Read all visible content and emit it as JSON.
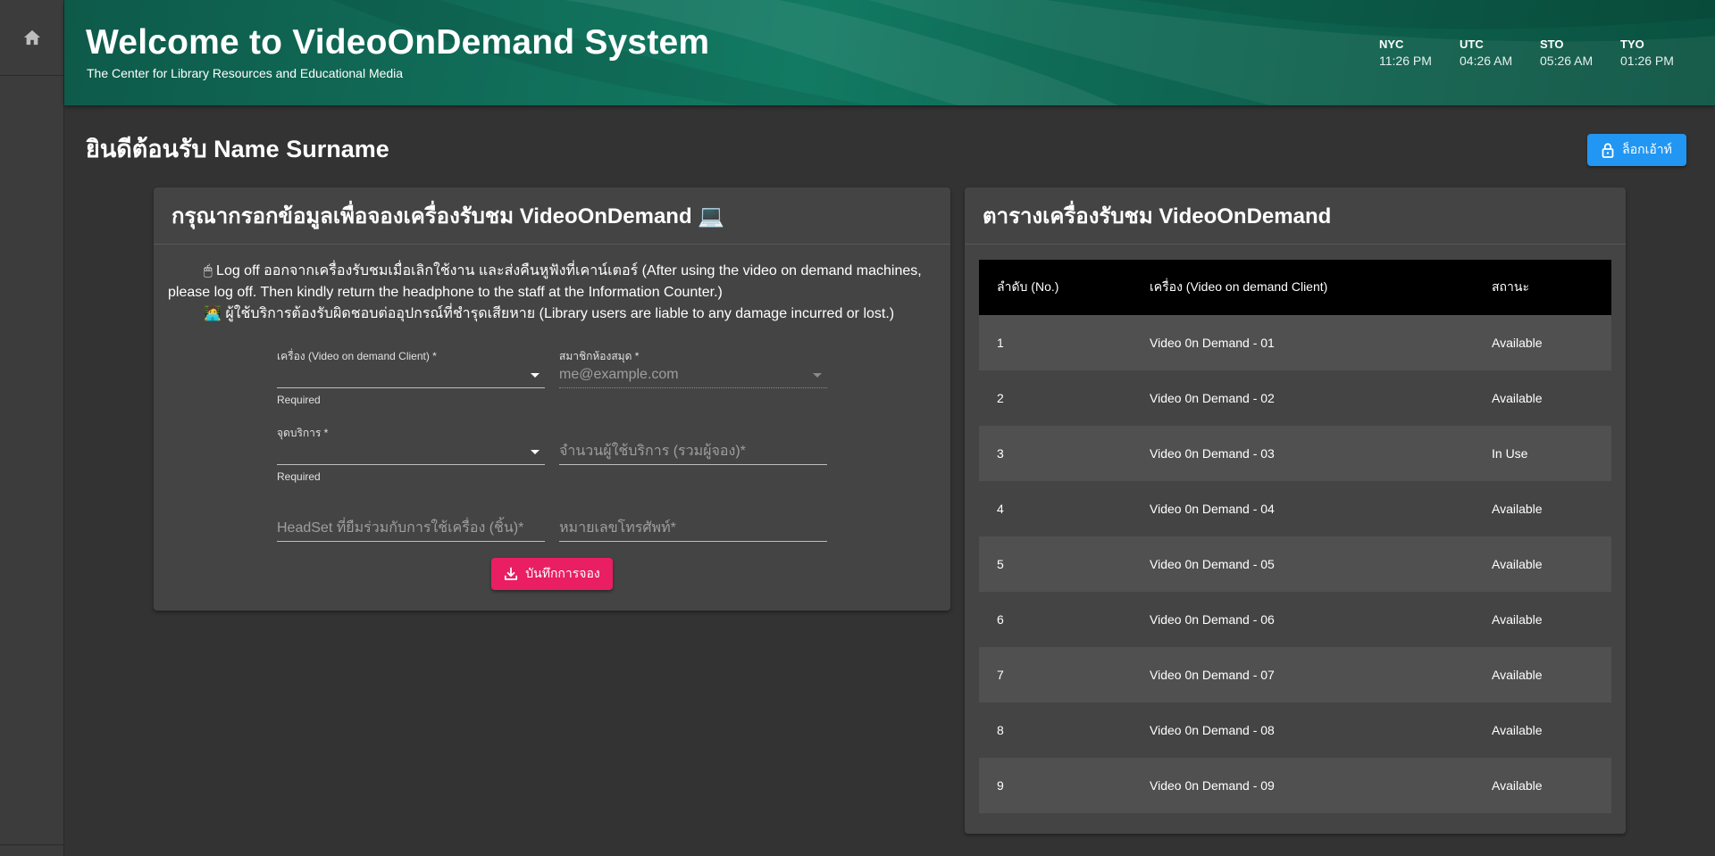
{
  "header": {
    "title": "Welcome to VideoOnDemand System",
    "subtitle": "The Center for Library Resources and Educational Media",
    "clocks": [
      {
        "city": "NYC",
        "time": "11:26 PM"
      },
      {
        "city": "UTC",
        "time": "04:26 AM"
      },
      {
        "city": "STO",
        "time": "05:26 AM"
      },
      {
        "city": "TYO",
        "time": "01:26 PM"
      }
    ]
  },
  "welcome": "ยินดีต้อนรับ Name Surname",
  "logout_label": "ล็อกเอ้าท์",
  "form": {
    "title": "กรุณากรอกข้อมูลเพื่อจองเครื่องรับชม VideoOnDemand 💻",
    "notice_line1": "🖱 Log off ออกจากเครื่องรับชมเมื่อเลิกใช้งาน และส่งคืนหูฟังที่เคาน์เตอร์ (After using the video on demand machines,",
    "notice_line2": "please log off. Then kindly return the headphone to the staff at the Information Counter.)",
    "notice_line3": "🧑‍💻 ผู้ใช้บริการต้องรับผิดชอบต่ออุปกรณ์ที่ชำรุดเสียหาย (Library users are liable to any damage incurred or lost.)",
    "machine_label": "เครื่อง (Video on demand Client) *",
    "machine_hint": "Required",
    "member_label": "สมาชิกห้องสมุด *",
    "member_placeholder": "me@example.com",
    "service_point_label": "จุดบริการ *",
    "service_point_hint": "Required",
    "user_count_placeholder": "จำนวนผู้ใช้บริการ (รวมผู้จอง)*",
    "headset_placeholder": "HeadSet ที่ยืมร่วมกับการใช้เครื่อง (ชิ้น)*",
    "phone_placeholder": "หมายเลขโทรศัพท์*",
    "save_label": "บันทึกการจอง"
  },
  "table": {
    "title": "ตารางเครื่องรับชม VideoOnDemand",
    "columns": [
      "ลำดับ (No.)",
      "เครื่อง (Video on demand Client)",
      "สถานะ"
    ],
    "rows": [
      {
        "no": "1",
        "name": "Video 0n Demand - 01",
        "status": "Available"
      },
      {
        "no": "2",
        "name": "Video 0n Demand - 02",
        "status": "Available"
      },
      {
        "no": "3",
        "name": "Video 0n Demand - 03",
        "status": "In Use"
      },
      {
        "no": "4",
        "name": "Video 0n Demand - 04",
        "status": "Available"
      },
      {
        "no": "5",
        "name": "Video 0n Demand - 05",
        "status": "Available"
      },
      {
        "no": "6",
        "name": "Video 0n Demand - 06",
        "status": "Available"
      },
      {
        "no": "7",
        "name": "Video 0n Demand - 07",
        "status": "Available"
      },
      {
        "no": "8",
        "name": "Video 0n Demand - 08",
        "status": "Available"
      },
      {
        "no": "9",
        "name": "Video 0n Demand - 09",
        "status": "Available"
      }
    ]
  },
  "colors": {
    "header_green": "#127a62",
    "logout_blue": "#2196f3",
    "save_pink": "#e91e63",
    "background": "#333333",
    "card": "#444444"
  },
  "icons": {
    "sidebar": "home-icon",
    "logout": "lock-icon",
    "save": "download-icon"
  }
}
